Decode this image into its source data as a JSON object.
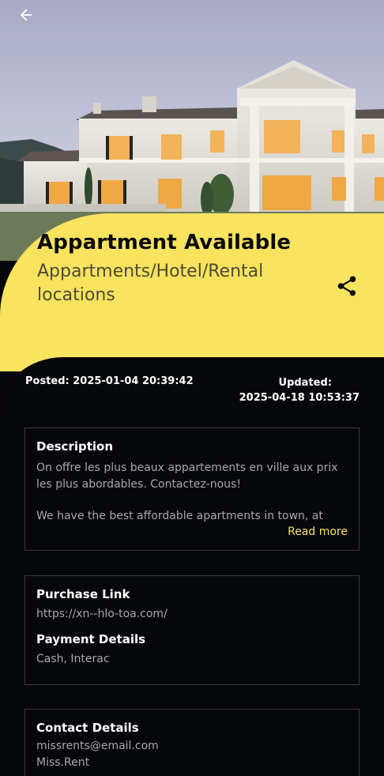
{
  "header": {
    "back_icon": "arrow-left-icon",
    "share_icon": "share-icon"
  },
  "listing": {
    "title": "Appartment Available",
    "category": "Appartments/Hotel/Rental locations",
    "posted": "Posted: 2025-01-04 20:39:42",
    "updated_label": "Updated:",
    "updated_value": "2025-04-18 10:53:37"
  },
  "description": {
    "heading": "Description",
    "text_fr": "On offre les plus beaux appartements en ville aux prix les plus abordables. Contactez-nous!",
    "text_en": "We have the best affordable apartments in town, at",
    "read_more": "Read more"
  },
  "purchase": {
    "link_heading": "Purchase Link",
    "link_value": "https://xn--hlo-toa.com/",
    "payment_heading": "Payment Details",
    "payment_value": "Cash, Interac"
  },
  "contact": {
    "heading": "Contact Details",
    "email": "missrents@email.com",
    "name": "Miss.Rent"
  },
  "colors": {
    "accent_yellow": "#f9e35f",
    "background_dark": "#06070b"
  }
}
